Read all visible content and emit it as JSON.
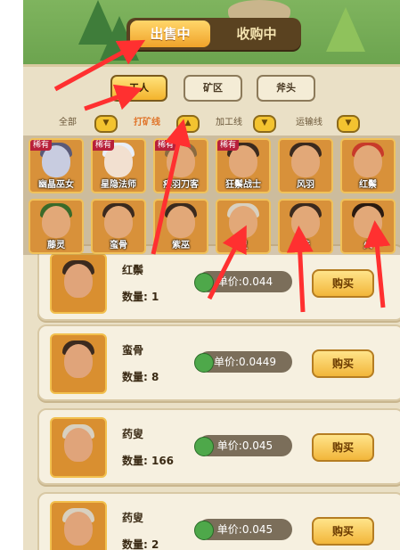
{
  "top_tabs": {
    "sell": "出售中",
    "buy": "收购中"
  },
  "sub_tabs": [
    {
      "label": "工人",
      "active": true
    },
    {
      "label": "矿区",
      "active": false
    },
    {
      "label": "斧头",
      "active": false
    }
  ],
  "filters": [
    {
      "label": "全部",
      "active": false,
      "chevron": "▼"
    },
    {
      "label": "打矿线",
      "active": true,
      "chevron": "▲"
    },
    {
      "label": "加工线",
      "active": false,
      "chevron": "▼"
    },
    {
      "label": "运输线",
      "active": false,
      "chevron": "▼"
    }
  ],
  "worker_cards_row1": [
    {
      "name": "幽晶巫女",
      "rare": "稀有"
    },
    {
      "name": "星隐法师",
      "rare": "稀有"
    },
    {
      "name": "疾羽刀客",
      "rare": "稀有"
    },
    {
      "name": "狂鬃战士",
      "rare": "稀有"
    },
    {
      "name": "风羽",
      "rare": ""
    },
    {
      "name": "红鬃",
      "rare": ""
    }
  ],
  "worker_cards_row2": [
    {
      "name": "藤灵",
      "rare": ""
    },
    {
      "name": "蛮骨",
      "rare": ""
    },
    {
      "name": "紫巫",
      "rare": ""
    },
    {
      "name": "叟",
      "rare": ""
    },
    {
      "name": "娃",
      "rare": ""
    },
    {
      "name": "火",
      "rare": ""
    }
  ],
  "listings": [
    {
      "name": "红鬃",
      "qty": "数量: 1",
      "price": "单价:0.044",
      "buy": "购买"
    },
    {
      "name": "蛮骨",
      "qty": "数量: 8",
      "price": "单价:0.0449",
      "buy": "购买"
    },
    {
      "name": "药叟",
      "qty": "数量: 166",
      "price": "单价:0.045",
      "buy": "购买"
    },
    {
      "name": "药叟",
      "qty": "数量: 2",
      "price": "单价:0.045",
      "buy": "购买"
    }
  ],
  "colors": {
    "accent": "#f3b32c",
    "arrow": "#ff3030",
    "panel": "#eae0c6"
  }
}
